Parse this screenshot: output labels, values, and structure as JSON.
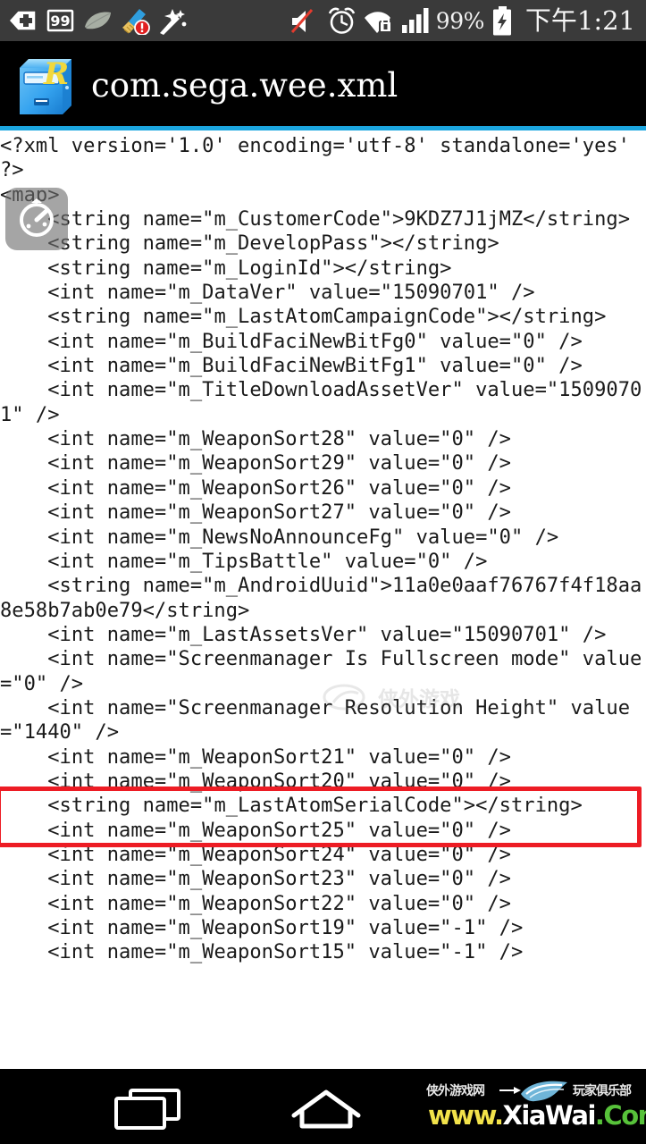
{
  "status_bar": {
    "background": "#3a3a3a",
    "left_icons": [
      {
        "name": "back-plus-icon",
        "label": "back-plus"
      },
      {
        "name": "notification-count-icon",
        "label": "99"
      },
      {
        "name": "leaf-icon",
        "label": "leaf"
      },
      {
        "name": "broom-clean-alert-icon",
        "label": "clean-alert"
      },
      {
        "name": "magic-wand-icon",
        "label": "magic-wand"
      }
    ],
    "right_icons": [
      {
        "name": "mute-icon",
        "label": "muted"
      },
      {
        "name": "alarm-clock-icon",
        "label": "alarm"
      },
      {
        "name": "wifi-secure-icon",
        "label": "wifi-locked"
      },
      {
        "name": "signal-bars-icon",
        "label": "signal-full"
      }
    ],
    "battery_percent": "99%",
    "battery_state": "charging",
    "clock": "下午1:21"
  },
  "title_bar": {
    "app_icon": "re-file-manager-icon",
    "title": "com.sega.wee.xml",
    "divider_color": "#1ba6e0"
  },
  "float_widget": {
    "icon": "speed-gauge-icon"
  },
  "editor": {
    "text": "<?xml version='1.0' encoding='utf-8' standalone='yes' ?>\n<map>\n    <string name=\"m_CustomerCode\">9KDZ7J1jMZ</string>\n    <string name=\"m_DevelopPass\"></string>\n    <string name=\"m_LoginId\"></string>\n    <int name=\"m_DataVer\" value=\"15090701\" />\n    <string name=\"m_LastAtomCampaignCode\"></string>\n    <int name=\"m_BuildFaciNewBitFg0\" value=\"0\" />\n    <int name=\"m_BuildFaciNewBitFg1\" value=\"0\" />\n    <int name=\"m_TitleDownloadAssetVer\" value=\"15090701\" />\n    <int name=\"m_WeaponSort28\" value=\"0\" />\n    <int name=\"m_WeaponSort29\" value=\"0\" />\n    <int name=\"m_WeaponSort26\" value=\"0\" />\n    <int name=\"m_WeaponSort27\" value=\"0\" />\n    <int name=\"m_NewsNoAnnounceFg\" value=\"0\" />\n    <int name=\"m_TipsBattle\" value=\"0\" />\n    <string name=\"m_AndroidUuid\">11a0e0aaf76767f4f18aa8e58b7ab0e79</string>\n    <int name=\"m_LastAssetsVer\" value=\"15090701\" />\n    <int name=\"Screenmanager Is Fullscreen mode\" value=\"0\" />\n    <int name=\"Screenmanager Resolution Height\" value=\"1440\" />\n    <int name=\"m_WeaponSort21\" value=\"0\" />\n    <int name=\"m_WeaponSort20\" value=\"0\" />\n    <string name=\"m_LastAtomSerialCode\"></string>\n    <int name=\"m_WeaponSort25\" value=\"0\" />\n    <int name=\"m_WeaponSort24\" value=\"0\" />\n    <int name=\"m_WeaponSort23\" value=\"0\" />\n    <int name=\"m_WeaponSort22\" value=\"0\" />\n    <int name=\"m_WeaponSort19\" value=\"-1\" />\n    <int name=\"m_WeaponSort15\" value=\"-1\" />",
    "highlighted_value": "11a0e0aaf76767f4f18aa8e58b7ab0e79",
    "highlight_color": "#ed1c24"
  },
  "body_watermark": {
    "text": "侠外游戏网"
  },
  "nav_bar": {
    "recents_label": "recents",
    "home_label": "home",
    "watermark": {
      "left_cn": "侠外游戏网",
      "right_cn": "玩家俱乐部",
      "url_a": "www.",
      "url_b": "XiaWai",
      "url_c": ".Com"
    }
  }
}
